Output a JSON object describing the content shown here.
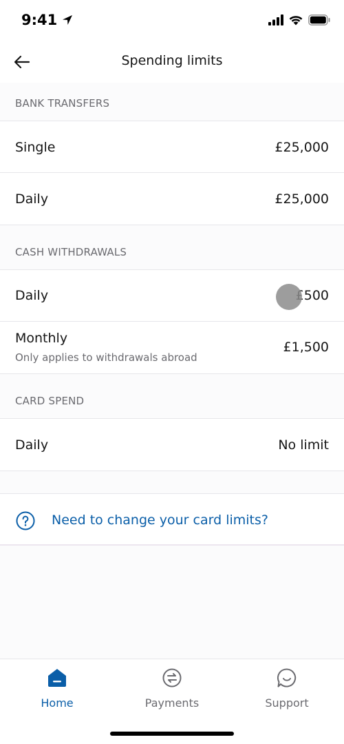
{
  "status_bar": {
    "time": "9:41",
    "icons": [
      "location-arrow-icon",
      "cellular-signal-icon",
      "wifi-icon",
      "battery-icon"
    ]
  },
  "header": {
    "title": "Spending limits",
    "back_icon": "arrow-left-icon"
  },
  "sections": [
    {
      "title": "BANK TRANSFERS",
      "rows": [
        {
          "label": "Single",
          "value": "£25,000"
        },
        {
          "label": "Daily",
          "value": "£25,000"
        }
      ]
    },
    {
      "title": "CASH WITHDRAWALS",
      "rows": [
        {
          "label": "Daily",
          "value": "£500"
        },
        {
          "label": "Monthly",
          "sublabel": "Only applies to withdrawals abroad",
          "value": "£1,500"
        }
      ]
    },
    {
      "title": "CARD SPEND",
      "rows": [
        {
          "label": "Daily",
          "value": "No limit"
        }
      ]
    }
  ],
  "help_link": {
    "text": "Need to change your card limits?",
    "icon": "question-circle-icon"
  },
  "tab_bar": {
    "active": "Home",
    "tabs": [
      {
        "label": "Home",
        "icon": "home-icon"
      },
      {
        "label": "Payments",
        "icon": "transfer-arrows-icon"
      },
      {
        "label": "Support",
        "icon": "chat-bubble-icon"
      }
    ]
  },
  "colors": {
    "accent": "#0a5ea8",
    "background": "#fbfbfc",
    "text": "#151515",
    "secondary_text": "#6a6a6f"
  }
}
